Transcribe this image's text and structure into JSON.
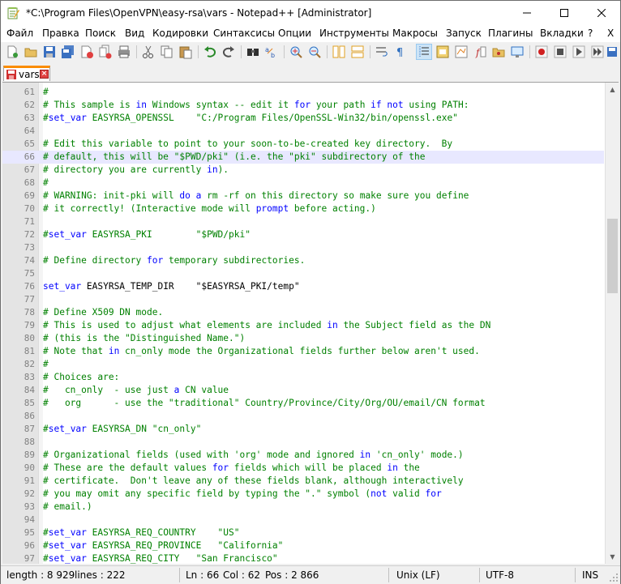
{
  "window": {
    "title": "*C:\\Program Files\\OpenVPN\\easy-rsa\\vars - Notepad++ [Administrator]",
    "minimize_icon": "minimize-icon",
    "maximize_icon": "maximize-icon",
    "close_icon": "close-icon"
  },
  "menu": [
    {
      "label": "Файл"
    },
    {
      "label": "Правка"
    },
    {
      "label": "Поиск"
    },
    {
      "label": "Вид"
    },
    {
      "label": "Кодировки"
    },
    {
      "label": "Синтаксисы"
    },
    {
      "label": "Опции"
    },
    {
      "label": "Инструменты"
    },
    {
      "label": "Макросы"
    },
    {
      "label": "Запуск"
    },
    {
      "label": "Плагины"
    },
    {
      "label": "Вкладки"
    },
    {
      "label": "?"
    },
    {
      "label": "X"
    }
  ],
  "tab": {
    "label": "vars"
  },
  "editor": {
    "lines": [
      {
        "n": "61",
        "t": "#"
      },
      {
        "n": "62",
        "t": "# This sample is in Windows syntax -- edit it for your path if not using PATH:"
      },
      {
        "n": "63",
        "t": "#set_var EASYRSA_OPENSSL    \"C:/Program Files/OpenSSL-Win32/bin/openssl.exe\""
      },
      {
        "n": "64",
        "t": ""
      },
      {
        "n": "65",
        "t": "# Edit this variable to point to your soon-to-be-created key directory.  By"
      },
      {
        "n": "66",
        "t": "# default, this will be \"$PWD/pki\" (i.e. the \"pki\" subdirectory of the"
      },
      {
        "n": "67",
        "t": "# directory you are currently in)."
      },
      {
        "n": "68",
        "t": "#"
      },
      {
        "n": "69",
        "t": "# WARNING: init-pki will do a rm -rf on this directory so make sure you define"
      },
      {
        "n": "70",
        "t": "# it correctly! (Interactive mode will prompt before acting.)"
      },
      {
        "n": "71",
        "t": ""
      },
      {
        "n": "72",
        "t": "#set_var EASYRSA_PKI        \"$PWD/pki\""
      },
      {
        "n": "73",
        "t": ""
      },
      {
        "n": "74",
        "t": "# Define directory for temporary subdirectories."
      },
      {
        "n": "75",
        "t": ""
      },
      {
        "n": "76",
        "t": "set_var EASYRSA_TEMP_DIR    \"$EASYRSA_PKI/temp\""
      },
      {
        "n": "77",
        "t": ""
      },
      {
        "n": "78",
        "t": "# Define X509 DN mode."
      },
      {
        "n": "79",
        "t": "# This is used to adjust what elements are included in the Subject field as the DN"
      },
      {
        "n": "80",
        "t": "# (this is the \"Distinguished Name.\")"
      },
      {
        "n": "81",
        "t": "# Note that in cn_only mode the Organizational fields further below aren't used."
      },
      {
        "n": "82",
        "t": "#"
      },
      {
        "n": "83",
        "t": "# Choices are:"
      },
      {
        "n": "84",
        "t": "#   cn_only  - use just a CN value"
      },
      {
        "n": "85",
        "t": "#   org      - use the \"traditional\" Country/Province/City/Org/OU/email/CN format"
      },
      {
        "n": "86",
        "t": ""
      },
      {
        "n": "87",
        "t": "#set_var EASYRSA_DN \"cn_only\""
      },
      {
        "n": "88",
        "t": ""
      },
      {
        "n": "89",
        "t": "# Organizational fields (used with 'org' mode and ignored in 'cn_only' mode.)"
      },
      {
        "n": "90",
        "t": "# These are the default values for fields which will be placed in the"
      },
      {
        "n": "91",
        "t": "# certificate.  Don't leave any of these fields blank, although interactively"
      },
      {
        "n": "92",
        "t": "# you may omit any specific field by typing the \".\" symbol (not valid for"
      },
      {
        "n": "93",
        "t": "# email.)"
      },
      {
        "n": "94",
        "t": ""
      },
      {
        "n": "95",
        "t": "#set_var EASYRSA_REQ_COUNTRY    \"US\""
      },
      {
        "n": "96",
        "t": "#set_var EASYRSA_REQ_PROVINCE   \"California\""
      },
      {
        "n": "97",
        "t": "#set_var EASYRSA_REQ_CITY   \"San Francisco\""
      }
    ],
    "current_line": "66"
  },
  "status": {
    "length": "length : 8 929",
    "lines": "lines : 222",
    "ln": "Ln : 66",
    "col": "Col : 62",
    "pos": "Pos : 2 866",
    "eol": "Unix (LF)",
    "encoding": "UTF-8",
    "mode": "INS"
  }
}
